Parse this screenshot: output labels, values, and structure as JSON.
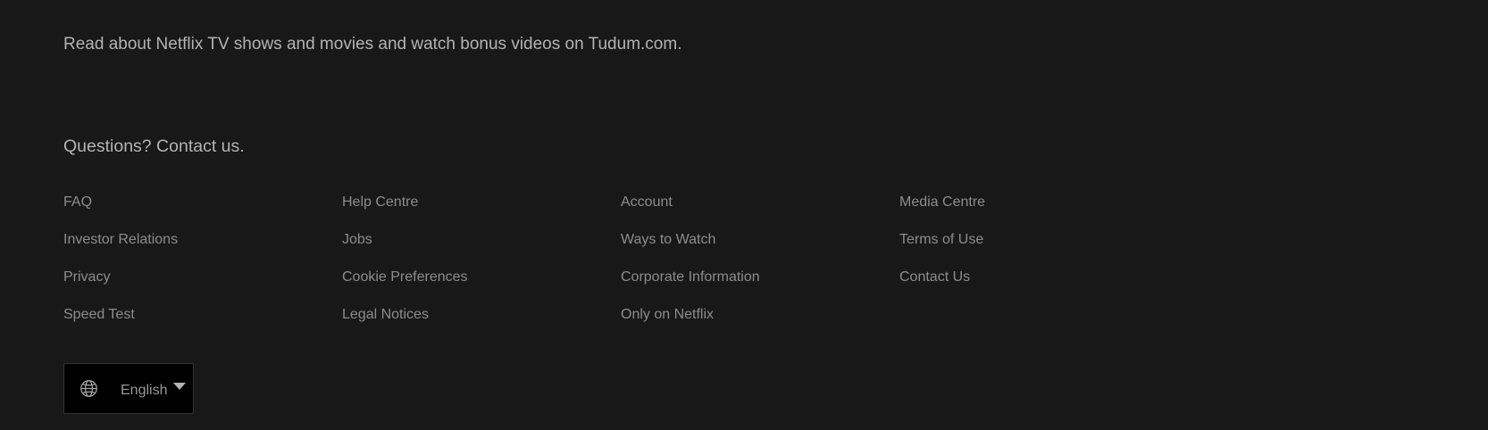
{
  "tudum": {
    "text": "Read about Netflix TV shows and movies and watch bonus videos on Tudum.com."
  },
  "contact": {
    "text": "Questions? Contact us."
  },
  "links": [
    {
      "label": "FAQ",
      "name": "link-faq"
    },
    {
      "label": "Help Centre",
      "name": "link-help-centre"
    },
    {
      "label": "Account",
      "name": "link-account"
    },
    {
      "label": "Media Centre",
      "name": "link-media-centre"
    },
    {
      "label": "Investor Relations",
      "name": "link-investor-relations"
    },
    {
      "label": "Jobs",
      "name": "link-jobs"
    },
    {
      "label": "Ways to Watch",
      "name": "link-ways-to-watch"
    },
    {
      "label": "Terms of Use",
      "name": "link-terms-of-use"
    },
    {
      "label": "Privacy",
      "name": "link-privacy"
    },
    {
      "label": "Cookie Preferences",
      "name": "link-cookie-preferences"
    },
    {
      "label": "Corporate Information",
      "name": "link-corporate-information"
    },
    {
      "label": "Contact Us",
      "name": "link-contact-us"
    },
    {
      "label": "Speed Test",
      "name": "link-speed-test"
    },
    {
      "label": "Legal Notices",
      "name": "link-legal-notices"
    },
    {
      "label": "Only on Netflix",
      "name": "link-only-on-netflix"
    }
  ],
  "language_selector": {
    "selected": "English",
    "icon": "globe-icon",
    "caret_icon": "caret-down-icon"
  },
  "colors": {
    "background": "#181818",
    "text": "#b3b3b3",
    "link": "#8c8c8c",
    "selector_bg": "#000000",
    "selector_border": "#333333"
  }
}
